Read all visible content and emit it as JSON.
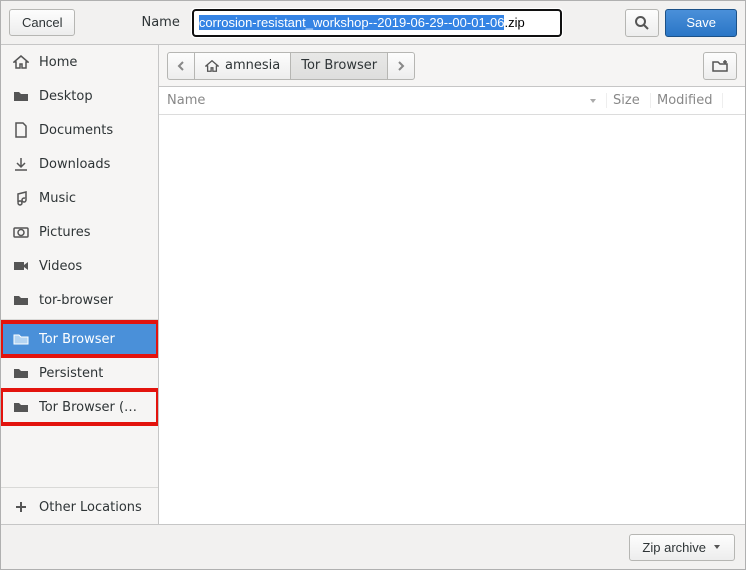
{
  "header": {
    "cancel": "Cancel",
    "name_label": "Name",
    "filename_value": "corrosion-resistant_workshop--2019-06-29--00-01-06.zip",
    "save": "Save"
  },
  "sidebar": {
    "items": [
      {
        "label": "Home",
        "icon": "home"
      },
      {
        "label": "Desktop",
        "icon": "folder"
      },
      {
        "label": "Documents",
        "icon": "document"
      },
      {
        "label": "Downloads",
        "icon": "download"
      },
      {
        "label": "Music",
        "icon": "music"
      },
      {
        "label": "Pictures",
        "icon": "camera"
      },
      {
        "label": "Videos",
        "icon": "video"
      },
      {
        "label": "tor-browser",
        "icon": "folder"
      },
      {
        "label": "Tor Browser",
        "icon": "folder-open",
        "selected": true,
        "highlight": true
      },
      {
        "label": "Persistent",
        "icon": "folder"
      },
      {
        "label": "Tor Browser (…",
        "icon": "folder",
        "highlight": true
      }
    ],
    "other_locations": "Other Locations"
  },
  "pathbar": {
    "segments": [
      {
        "label": "amnesia",
        "icon": "home"
      },
      {
        "label": "Tor Browser"
      }
    ]
  },
  "columns": {
    "name": "Name",
    "size": "Size",
    "modified": "Modified"
  },
  "footer": {
    "format": "Zip archive"
  }
}
